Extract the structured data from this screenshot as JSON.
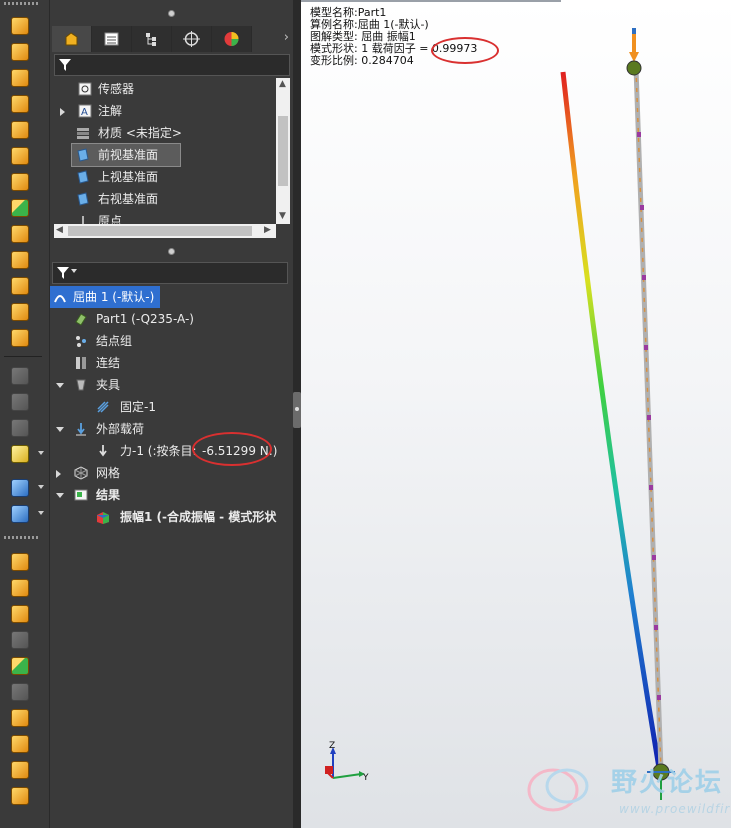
{
  "top_tree": {
    "items": [
      {
        "label": "传感器",
        "icon": "sensor-icon"
      },
      {
        "label": "注解",
        "icon": "annotation-icon"
      },
      {
        "label": "材质 <未指定>",
        "icon": "material-icon"
      },
      {
        "label": "前视基准面",
        "icon": "plane-icon"
      },
      {
        "label": "上视基准面",
        "icon": "plane-icon"
      },
      {
        "label": "右视基准面",
        "icon": "plane-icon"
      },
      {
        "label": "原点",
        "icon": "origin-icon"
      }
    ]
  },
  "sim_tree": {
    "study": "屈曲 1 (-默认-)",
    "part": "Part1 (-Q235-A-)",
    "nodes": "结点组",
    "connections": "连结",
    "fixtures": "夹具",
    "fixture_item": "固定-1",
    "loads": "外部载荷",
    "load_item_prefix": "力-1 (:按条目:",
    "load_item_value": "-6.51299 N:)",
    "mesh": "网格",
    "results": "结果",
    "result_item": "振幅1 (-合成振幅 - 模式形状"
  },
  "info": {
    "line1": "模型名称:Part1",
    "line2": "算例名称:屈曲 1(-默认-)",
    "line3": "图解类型: 屈曲 振幅1",
    "line4_prefix": "模式形状: 1  载荷因子 ",
    "line4_value": "= 0.99973",
    "line5": "变形比例: 0.284704"
  },
  "triad": {
    "z": "Z",
    "y": "Y"
  },
  "watermark": {
    "text": "野火论坛",
    "url": "www.proewildfire.cn"
  },
  "colors": {
    "highlight": "#2f6fd0",
    "annotation_circle": "#d93030",
    "background": "#3c3c3c"
  }
}
